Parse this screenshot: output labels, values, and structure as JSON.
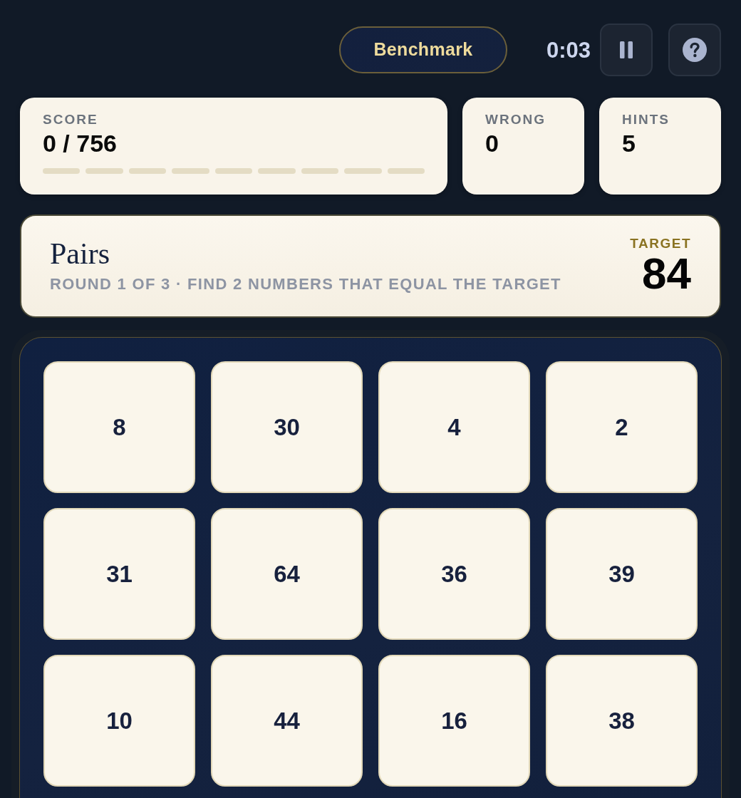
{
  "header": {
    "mode_button": "Benchmark",
    "timer": "0:03"
  },
  "stats": [
    {
      "kind": "progress",
      "label": "SCORE",
      "value": "0 / 756",
      "segments": [
        {
          "filled": false
        },
        {
          "filled": false
        },
        {
          "filled": false
        },
        {
          "filled": false
        },
        {
          "filled": false
        },
        {
          "filled": false
        },
        {
          "filled": false
        },
        {
          "filled": false
        },
        {
          "filled": false
        }
      ]
    },
    {
      "kind": "count",
      "label": "WRONG",
      "value": "0"
    },
    {
      "kind": "count",
      "label": "HINTS",
      "value": "5"
    }
  ],
  "puzzle": {
    "title": "Pairs",
    "subtitle": "ROUND 1 OF 3 · FIND 2 NUMBERS THAT EQUAL THE TARGET",
    "target_label": "TARGET",
    "target": "84"
  },
  "tiles": [
    {
      "value": "8",
      "selected": false
    },
    {
      "value": "30",
      "selected": false
    },
    {
      "value": "4",
      "selected": false
    },
    {
      "value": "2",
      "selected": false
    },
    {
      "value": "31",
      "selected": false
    },
    {
      "value": "64",
      "selected": false
    },
    {
      "value": "36",
      "selected": false
    },
    {
      "value": "39",
      "selected": false
    },
    {
      "value": "10",
      "selected": false
    },
    {
      "value": "44",
      "selected": false
    },
    {
      "value": "16",
      "selected": false
    },
    {
      "value": "38",
      "selected": false
    }
  ]
}
